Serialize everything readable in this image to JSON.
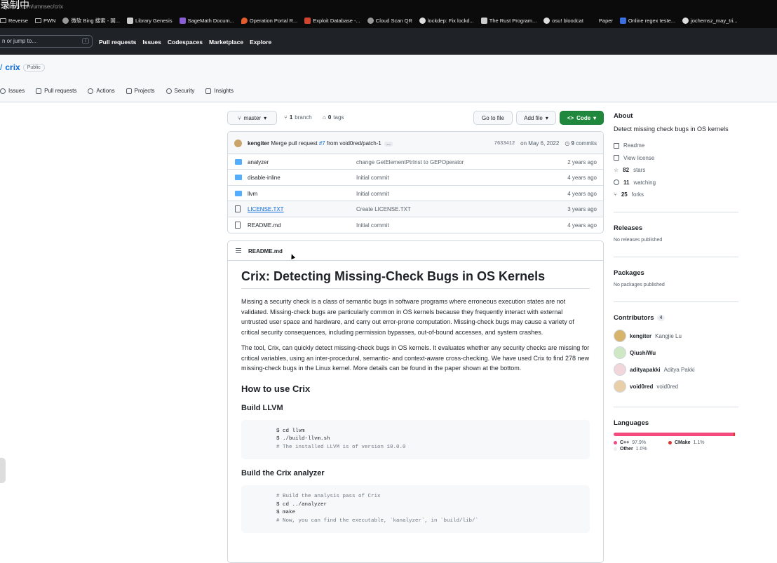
{
  "browser": {
    "recording_label": "录制中",
    "url": "github.com/umnsec/crix",
    "bookmarks": [
      {
        "icon": "folder-icon",
        "label": "Reverse"
      },
      {
        "icon": "folder-icon",
        "label": "PWN"
      },
      {
        "icon": "search-icon",
        "label": "微软 Bing 搜索 - 国..."
      },
      {
        "icon": "book-icon",
        "label": "Library Genesis"
      },
      {
        "icon": "sage-icon",
        "label": "SageMath Docum..."
      },
      {
        "icon": "pin-icon",
        "label": "Operation Portal R..."
      },
      {
        "icon": "database-icon",
        "label": "Exploit Database -..."
      },
      {
        "icon": "gear-icon",
        "label": "Cloud Scan QR"
      },
      {
        "icon": "github-icon",
        "label": "lockdep: Fix lockd..."
      },
      {
        "icon": "book-icon",
        "label": "The Rust Program..."
      },
      {
        "icon": "github-icon",
        "label": "osu! bloodcat"
      },
      {
        "icon": "blank-icon",
        "label": "Paper"
      },
      {
        "icon": "regex-icon",
        "label": "Online regex teste..."
      },
      {
        "icon": "github-icon",
        "label": "jochemsz_may_tri..."
      }
    ]
  },
  "header": {
    "search_placeholder": "n or jump to...",
    "search_key": "/",
    "nav": [
      "Pull requests",
      "Issues",
      "Codespaces",
      "Marketplace",
      "Explore"
    ]
  },
  "repo": {
    "slash": "/",
    "name": "crix",
    "visibility": "Public",
    "tabs": [
      "Issues",
      "Pull requests",
      "Actions",
      "Projects",
      "Security",
      "Insights"
    ]
  },
  "toolbar": {
    "branch": "master",
    "branch_count": "1",
    "branch_label": "branch",
    "tag_count": "0",
    "tag_label": "tags",
    "goto_file": "Go to file",
    "add_file": "Add file",
    "code": "Code"
  },
  "latest_commit": {
    "author": "kengiter",
    "message_prefix": "Merge pull request",
    "pr": "#7",
    "message_suffix": "from void0red/patch-1",
    "ellipsis": "...",
    "sha": "7633412",
    "date": "on May 6, 2022",
    "commit_count": "9",
    "commit_label": "commits"
  },
  "files": [
    {
      "type": "dir",
      "name": "analyzer",
      "message": "change GetElementPtrInst to GEPOperator",
      "age": "2 years ago"
    },
    {
      "type": "dir",
      "name": "disable-inline",
      "message": "Initial commit",
      "age": "4 years ago"
    },
    {
      "type": "dir",
      "name": "llvm",
      "message": "Initial commit",
      "age": "4 years ago"
    },
    {
      "type": "file",
      "name": "LICENSE.TXT",
      "message": "Create LICENSE.TXT",
      "age": "3 years ago"
    },
    {
      "type": "file",
      "name": "README.md",
      "message": "Initial commit",
      "age": "4 years ago"
    }
  ],
  "readme": {
    "filename": "README.md",
    "title": "Crix: Detecting Missing-Check Bugs in OS Kernels",
    "p1": "Missing a security check is a class of semantic bugs in software programs where erroneous execution states are not validated. Missing-check bugs are particularly common in OS kernels because they frequently interact with external untrusted user space and hardware, and carry out error-prone computation. Missing-check bugs may cause a variety of critical security consequences, including permission bypasses, out-of-bound accesses, and system crashes.",
    "p2": "The tool, Crix, can quickly detect missing-check bugs in OS kernels. It evaluates whether any security checks are missing for critical variables, using an inter-procedural, semantic- and context-aware cross-checking. We have used Crix to find 278 new missing-check bugs in the Linux kernel. More details can be found in the paper shown at the bottom.",
    "h2": "How to use Crix",
    "h3_llvm": "Build LLVM",
    "code_llvm": [
      "$ cd llvm",
      "$ ./build-llvm.sh",
      "# The installed LLVM is of version 10.0.0"
    ],
    "h3_crix": "Build the Crix analyzer",
    "code_crix": [
      "# Build the analysis pass of Crix",
      "$ cd ../analyzer",
      "$ make",
      "# Now, you can find the executable, `kanalyzer`, in `build/lib/`"
    ]
  },
  "about": {
    "heading": "About",
    "description": "Detect missing check bugs in OS kernels",
    "readme": "Readme",
    "license": "View license",
    "stars_count": "82",
    "stars_label": "stars",
    "watching_count": "11",
    "watching_label": "watching",
    "forks_count": "25",
    "forks_label": "forks"
  },
  "releases": {
    "heading": "Releases",
    "empty": "No releases published"
  },
  "packages": {
    "heading": "Packages",
    "empty": "No packages published"
  },
  "contributors": {
    "heading": "Contributors",
    "count": "4",
    "list": [
      {
        "login": "kengiter",
        "name": "Kangjie Lu"
      },
      {
        "login": "QiushiWu",
        "name": ""
      },
      {
        "login": "adityapakki",
        "name": "Aditya Pakki"
      },
      {
        "login": "void0red",
        "name": "void0red"
      }
    ]
  },
  "languages": {
    "heading": "Languages",
    "list": [
      {
        "name": "C++",
        "percent": "97.9%",
        "value": 97.9,
        "color": "#f34b7d"
      },
      {
        "name": "CMake",
        "percent": "1.1%",
        "value": 1.1,
        "color": "#da3434"
      },
      {
        "name": "Other",
        "percent": "1.0%",
        "value": 1.0,
        "color": "#ededed"
      }
    ]
  }
}
